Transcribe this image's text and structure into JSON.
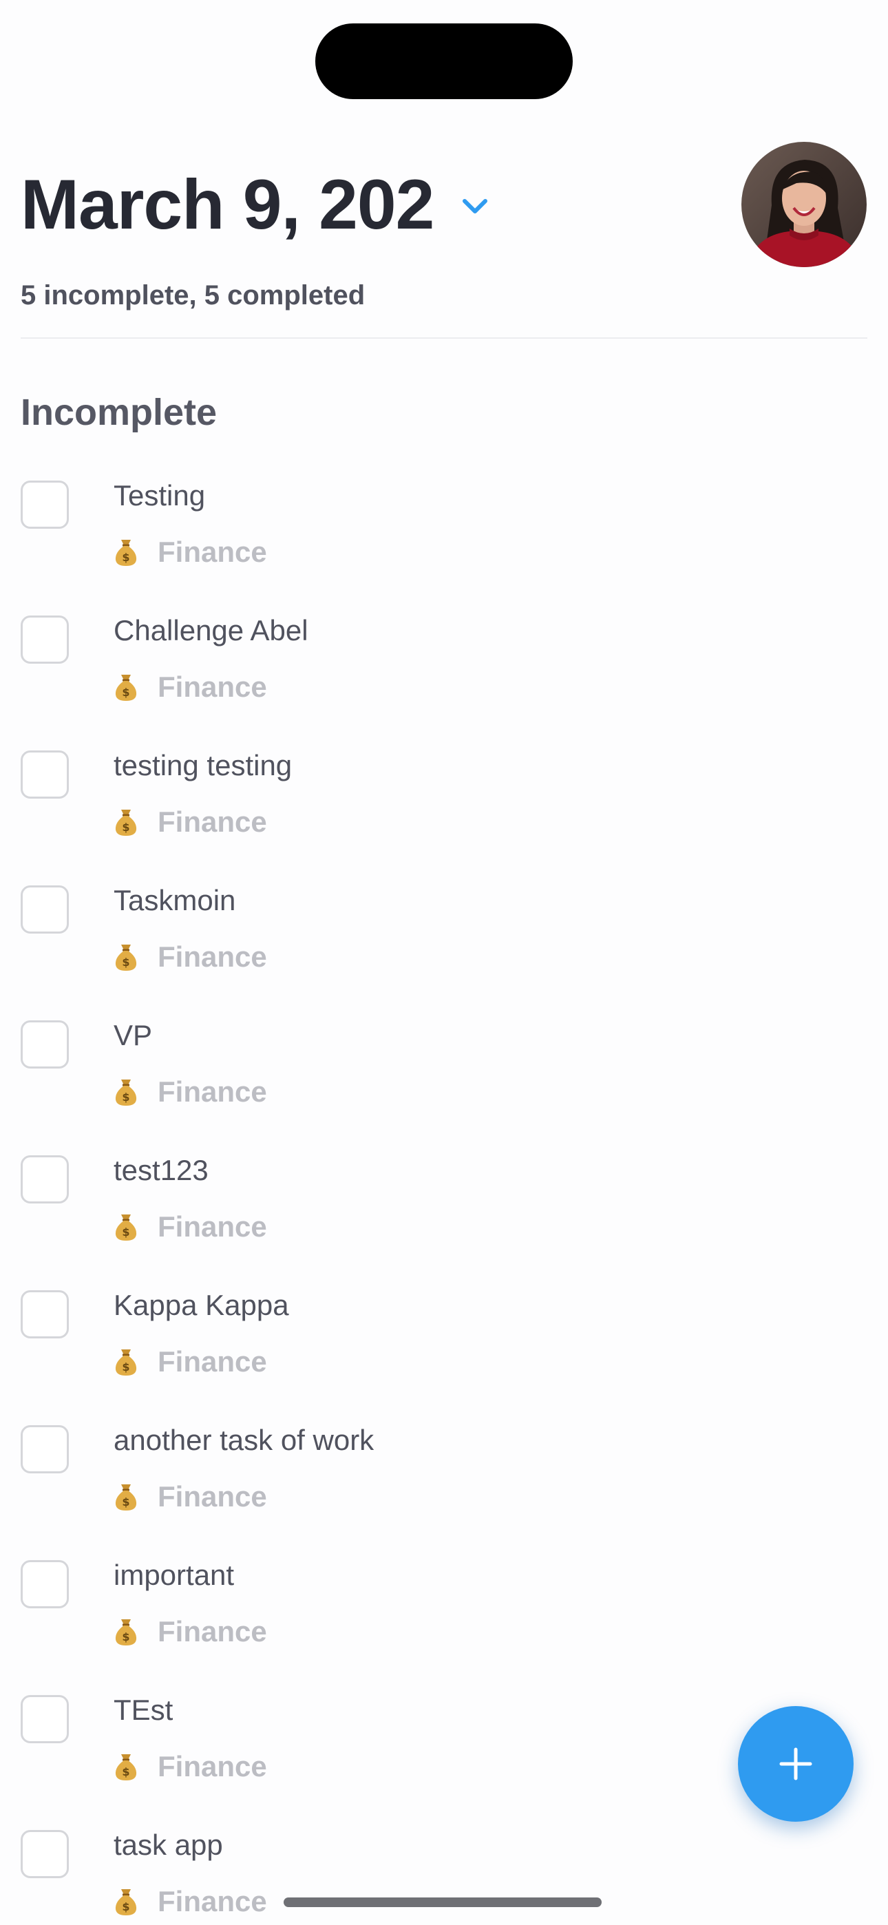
{
  "header": {
    "date_title": "March 9, 202",
    "summary": "5 incomplete, 5 completed"
  },
  "section": {
    "title": "Incomplete"
  },
  "tasks": [
    {
      "title": "Testing",
      "category": "Finance",
      "category_icon": "money-bag-icon"
    },
    {
      "title": "Challenge Abel",
      "category": "Finance",
      "category_icon": "money-bag-icon"
    },
    {
      "title": "testing testing",
      "category": "Finance",
      "category_icon": "money-bag-icon"
    },
    {
      "title": "Taskmoin",
      "category": "Finance",
      "category_icon": "money-bag-icon"
    },
    {
      "title": "VP",
      "category": "Finance",
      "category_icon": "money-bag-icon"
    },
    {
      "title": "test123",
      "category": "Finance",
      "category_icon": "money-bag-icon"
    },
    {
      "title": "Kappa Kappa",
      "category": "Finance",
      "category_icon": "money-bag-icon"
    },
    {
      "title": "another task of work",
      "category": "Finance",
      "category_icon": "money-bag-icon"
    },
    {
      "title": "important",
      "category": "Finance",
      "category_icon": "money-bag-icon"
    },
    {
      "title": "TEst",
      "category": "Finance",
      "category_icon": "money-bag-icon"
    },
    {
      "title": "task app",
      "category": "Finance",
      "category_icon": "money-bag-icon"
    }
  ],
  "colors": {
    "accent": "#2f9bf0",
    "title_text": "#272933",
    "muted_text": "#bcbdc3"
  }
}
